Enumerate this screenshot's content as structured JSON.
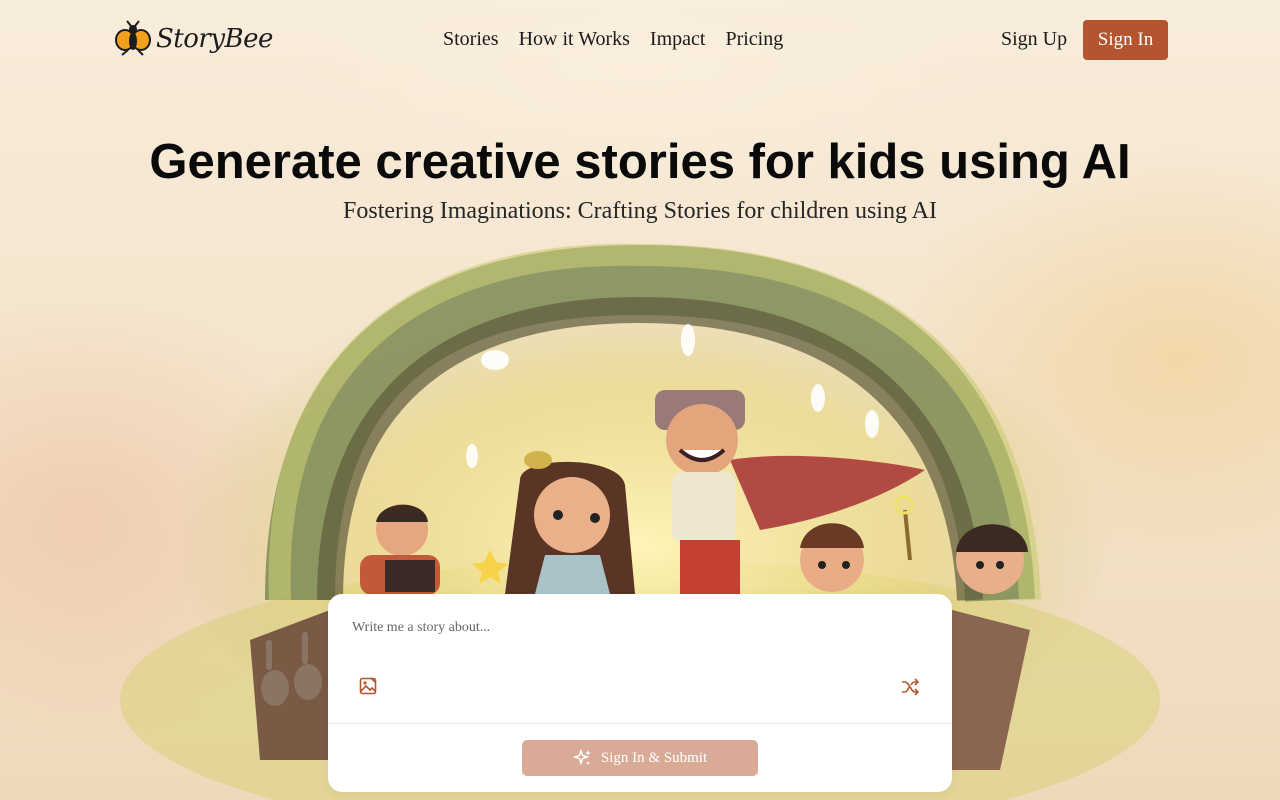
{
  "brand": {
    "name": "StoryBee",
    "logo_icon": "bee-icon",
    "accent": "#b5552f"
  },
  "nav": {
    "links": [
      "Stories",
      "How it Works",
      "Impact",
      "Pricing"
    ],
    "sign_up": "Sign Up",
    "sign_in": "Sign In"
  },
  "hero": {
    "title": "Generate creative stories for kids using AI",
    "subtitle": "Fostering Imaginations: Crafting Stories for children using AI",
    "illustration": "children-under-tree-arch"
  },
  "prompt": {
    "placeholder": "Write me a story about...",
    "image_icon": "image-upload-icon",
    "shuffle_icon": "shuffle-icon",
    "submit_label": "Sign In & Submit",
    "submit_icon": "sparkles-icon",
    "submit_color": "#d9ab97"
  }
}
